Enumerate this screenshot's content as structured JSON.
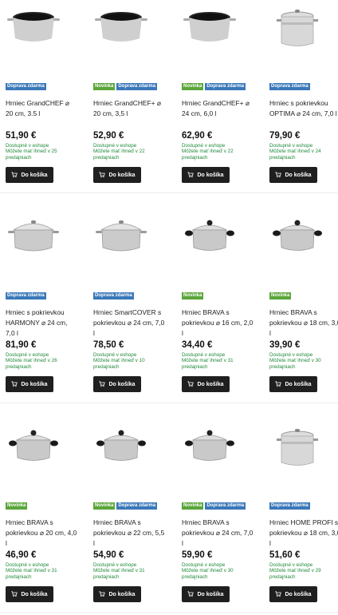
{
  "products": [
    {
      "badges": [
        {
          "text": "Doprava zdarma",
          "color": "blue"
        }
      ],
      "title": "Hrniec GrandCHEF ⌀ 20 cm, 3.5 l",
      "price": "51,90 €",
      "stock1": "Dostupné v eshope",
      "stock2": "Môžete mať ihneď v 25 predajniach",
      "button": "Do košíka",
      "pot": "wide-black"
    },
    {
      "badges": [
        {
          "text": "Novinka",
          "color": "green"
        },
        {
          "text": "Doprava zdarma",
          "color": "blue"
        }
      ],
      "title": "Hrniec GrandCHEF+ ⌀ 20 cm, 3,5 l",
      "price": "52,90 €",
      "stock1": "Dostupné v eshope",
      "stock2": "Môžete mať ihneď v 22 predajniach",
      "button": "Do košíka",
      "pot": "wide-black"
    },
    {
      "badges": [
        {
          "text": "Novinka",
          "color": "green"
        },
        {
          "text": "Doprava zdarma",
          "color": "blue"
        }
      ],
      "title": "Hrniec GrandCHEF+ ⌀ 24 cm, 6,0 l",
      "price": "62,90 €",
      "stock1": "Dostupné v eshope",
      "stock2": "Môžete mať ihneď v 22 predajniach",
      "button": "Do košíka",
      "pot": "wide-black"
    },
    {
      "badges": [
        {
          "text": "Doprava zdarma",
          "color": "blue"
        }
      ],
      "title": "Hrniec s pokrievkou OPTIMA ⌀ 24 cm, 7,0 l",
      "price": "79,90 €",
      "stock1": "Dostupné v eshope",
      "stock2": "Môžete mať ihneď v 24 predajniach",
      "button": "Do košíka",
      "pot": "tall-glass"
    },
    {
      "badges": [
        {
          "text": "Doprava zdarma",
          "color": "blue"
        }
      ],
      "title": "Hrniec s pokrievkou HARMONY ⌀ 24 cm, 7,0 l",
      "price": "81,90 €",
      "stock1": "Dostupné v eshope",
      "stock2": "Môžete mať ihneď v 26 predajniach",
      "button": "Do košíka",
      "pot": "steel-lid"
    },
    {
      "badges": [
        {
          "text": "Doprava zdarma",
          "color": "blue"
        }
      ],
      "title": "Hrniec SmartCOVER s pokrievkou ⌀ 24 cm, 7,0 l",
      "price": "78,50 €",
      "stock1": "Dostupné v eshope",
      "stock2": "Môžete mať ihneď v 10 predajniach",
      "button": "Do košíka",
      "pot": "steel-lid"
    },
    {
      "badges": [
        {
          "text": "Novinka",
          "color": "green"
        }
      ],
      "title": "Hrniec BRAVA s pokrievkou ⌀ 16 cm, 2,0 l",
      "price": "34,40 €",
      "stock1": "Dostupné v eshope",
      "stock2": "Môžete mať ihneď v 31 predajniach",
      "button": "Do košíka",
      "pot": "brava"
    },
    {
      "badges": [
        {
          "text": "Novinka",
          "color": "green"
        }
      ],
      "title": "Hrniec BRAVA s pokrievkou ⌀ 18 cm, 3,0 l",
      "price": "39,90 €",
      "stock1": "Dostupné v eshope",
      "stock2": "Môžete mať ihneď v 30 predajniach",
      "button": "Do košíka",
      "pot": "brava"
    },
    {
      "badges": [
        {
          "text": "Novinka",
          "color": "green"
        }
      ],
      "title": "Hrniec BRAVA s pokrievkou ⌀ 20 cm, 4,0 l",
      "price": "46,90 €",
      "stock1": "Dostupné v eshope",
      "stock2": "Môžete mať ihneď v 31 predajniach",
      "button": "Do košíka",
      "pot": "brava"
    },
    {
      "badges": [
        {
          "text": "Novinka",
          "color": "green"
        },
        {
          "text": "Doprava zdarma",
          "color": "blue"
        }
      ],
      "title": "Hrniec BRAVA s pokrievkou ⌀ 22 cm, 5,5 l",
      "price": "54,90 €",
      "stock1": "Dostupné v eshope",
      "stock2": "Môžete mať ihneď v 31 predajniach",
      "button": "Do košíka",
      "pot": "brava"
    },
    {
      "badges": [
        {
          "text": "Novinka",
          "color": "green"
        },
        {
          "text": "Doprava zdarma",
          "color": "blue"
        }
      ],
      "title": "Hrniec BRAVA s pokrievkou ⌀ 24 cm, 7,0 l",
      "price": "59,90 €",
      "stock1": "Dostupné v eshope",
      "stock2": "Môžete mať ihneď v 30 predajniach",
      "button": "Do košíka",
      "pot": "brava"
    },
    {
      "badges": [
        {
          "text": "Doprava zdarma",
          "color": "blue"
        }
      ],
      "title": "Hrniec HOME PROFI s pokrievkou ⌀ 18 cm, 3,0 l",
      "price": "51,60 €",
      "stock1": "Dostupné v eshope",
      "stock2": "Môžete mať ihneď v 29 predajniach",
      "button": "Do košíka",
      "pot": "tall-glass"
    }
  ]
}
